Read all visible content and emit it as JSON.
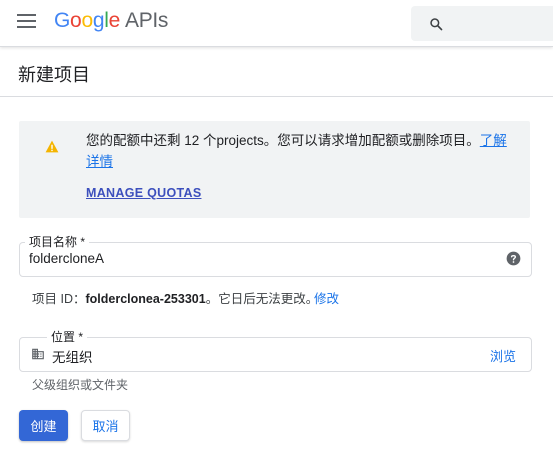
{
  "header": {
    "logo_letters": [
      {
        "char": "G",
        "color": "#4285F4"
      },
      {
        "char": "o",
        "color": "#EA4335"
      },
      {
        "char": "o",
        "color": "#FBBC05"
      },
      {
        "char": "g",
        "color": "#4285F4"
      },
      {
        "char": "l",
        "color": "#34A853"
      },
      {
        "char": "e",
        "color": "#EA4335"
      }
    ],
    "logo_suffix": "APIs",
    "menu_icon": "hamburger-menu-icon",
    "search_icon": "search-icon"
  },
  "page": {
    "title": "新建项目"
  },
  "quota_notice": {
    "icon": "warning-icon",
    "icon_color": "#F4B400",
    "message": "您的配额中还剩 12 个projects。您可以请求增加配额或删除项目。",
    "learn_more": "了解详情",
    "manage_link": "MANAGE QUOTAS"
  },
  "project_name": {
    "label": "项目名称 *",
    "value": "folderclonеA",
    "help_icon": "help-icon"
  },
  "project_id": {
    "prefix": "项目 ID：",
    "id": "folderclonea-253301",
    "suffix": "。它日后无法更改。",
    "edit_link": "修改"
  },
  "location": {
    "label": "位置 *",
    "icon": "organization-icon",
    "value": "无组织",
    "browse": "浏览",
    "hint": "父级组织或文件夹"
  },
  "actions": {
    "create": "创建",
    "cancel": "取消"
  },
  "colors": {
    "primary": "#3367d6",
    "link": "#1a73e8",
    "notice_bg": "#f1f3f4"
  }
}
